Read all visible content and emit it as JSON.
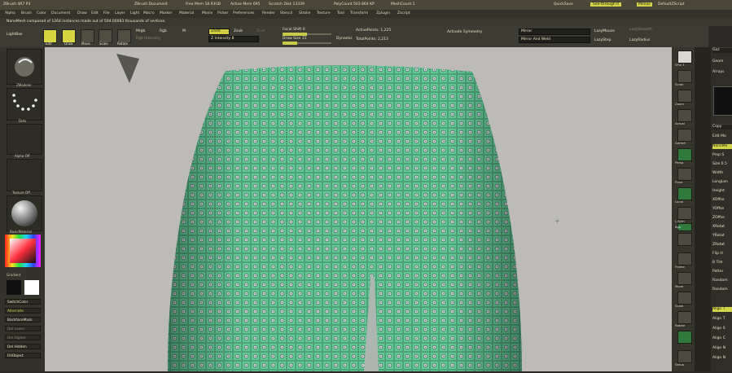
{
  "titlebar": {
    "app": "ZBrush 4R7 P3",
    "doc": "ZBrush Document",
    "mem": "Free Mem 18.93GB",
    "active": "Active Mem 695",
    "scratch": "Scratch Disk 13339",
    "polys": "PolyCount 503.864 KP",
    "mesh": "MeshCount 1",
    "quicksave": "QuickSave",
    "seethrough": "See-through 0",
    "menus": "Menus",
    "script": "DefaultZScript"
  },
  "menubar": [
    "Alpha",
    "Brush",
    "Color",
    "Document",
    "Draw",
    "Edit",
    "File",
    "Layer",
    "Light",
    "Macro",
    "Marker",
    "Material",
    "Movie",
    "Picker",
    "Preferences",
    "Render",
    "Stencil",
    "Stroke",
    "Texture",
    "Tool",
    "Transform",
    "Zplugin",
    "Zscript"
  ],
  "infobar": {
    "text": "NanoMesh composed of 1264 instances made out of 504.00083 thousands of vertices."
  },
  "toolbar": {
    "lightbox": "LightBox",
    "buttons": [
      {
        "label": "Edit",
        "active": true
      },
      {
        "label": "Draw",
        "active": true
      },
      {
        "label": "Move",
        "active": false
      },
      {
        "label": "Scale",
        "active": false
      },
      {
        "label": "Rotate",
        "active": false
      }
    ],
    "mrgb": "Mrgb",
    "rgb": "Rgb",
    "m": "M",
    "rgb_intensity": "Rgb Intensity",
    "zadd": "Zadd",
    "zsub": "Zsub",
    "zcut": "Zcut",
    "z_intensity": "Z Intensity 8",
    "focal_shift": "Focal Shift 0",
    "draw_size": "Draw Size 31",
    "dynamic": "Dynamic",
    "active_points": "ActivePoints: 1,225",
    "total_points": "TotalPoints: 2,213",
    "activate_symmetry": "Activate Symmetry",
    "mirror": "Mirror",
    "mirror_weld": "Mirror And Weld",
    "lazymouse": "LazyMouse",
    "lazystep": "LazyStep",
    "lazysmooth": "LazySmooth",
    "lazyradius": "LazyRadius"
  },
  "leftpanel": {
    "brush": "ZModeler",
    "stroke": "Dots",
    "alpha": "Alpha Off",
    "texture": "Texture Off",
    "material": "BasicMaterial",
    "gradient": "Gradient",
    "buttons": [
      "SwitchColor",
      "Alternate",
      "BackfaceMask",
      "Del Lower",
      "Del Higher",
      "Del Hidden",
      "FillObject"
    ]
  },
  "rightstrip": [
    "SPix 3",
    "Scroll",
    "Zoom",
    "Actual",
    "AAHalf",
    "Persp",
    "Floor",
    "Local",
    "L.Sym",
    "Xyz",
    "",
    "",
    "Frame",
    "Move",
    "Scale",
    "Rotate",
    "",
    "Setup"
  ],
  "farright": [
    "Goz",
    "Geom",
    "Arrays",
    "Copy",
    "Edit Mo",
    "NanoMe",
    "Prop S",
    "Size 0.5",
    "Width",
    "LongLen",
    "Height",
    "XOffse",
    "YOffse",
    "ZOffse",
    "XRotat",
    "YRotat",
    "ZRotat",
    "Flip H",
    "B Tile",
    "Patter",
    "Random",
    "Random",
    "Align T",
    "Align T",
    "Align S",
    "Align C",
    "Align N",
    "Align N"
  ],
  "colors": {
    "accent": "#d8d640",
    "mesh": "#5ec790",
    "bg": "#bcbbb8"
  }
}
